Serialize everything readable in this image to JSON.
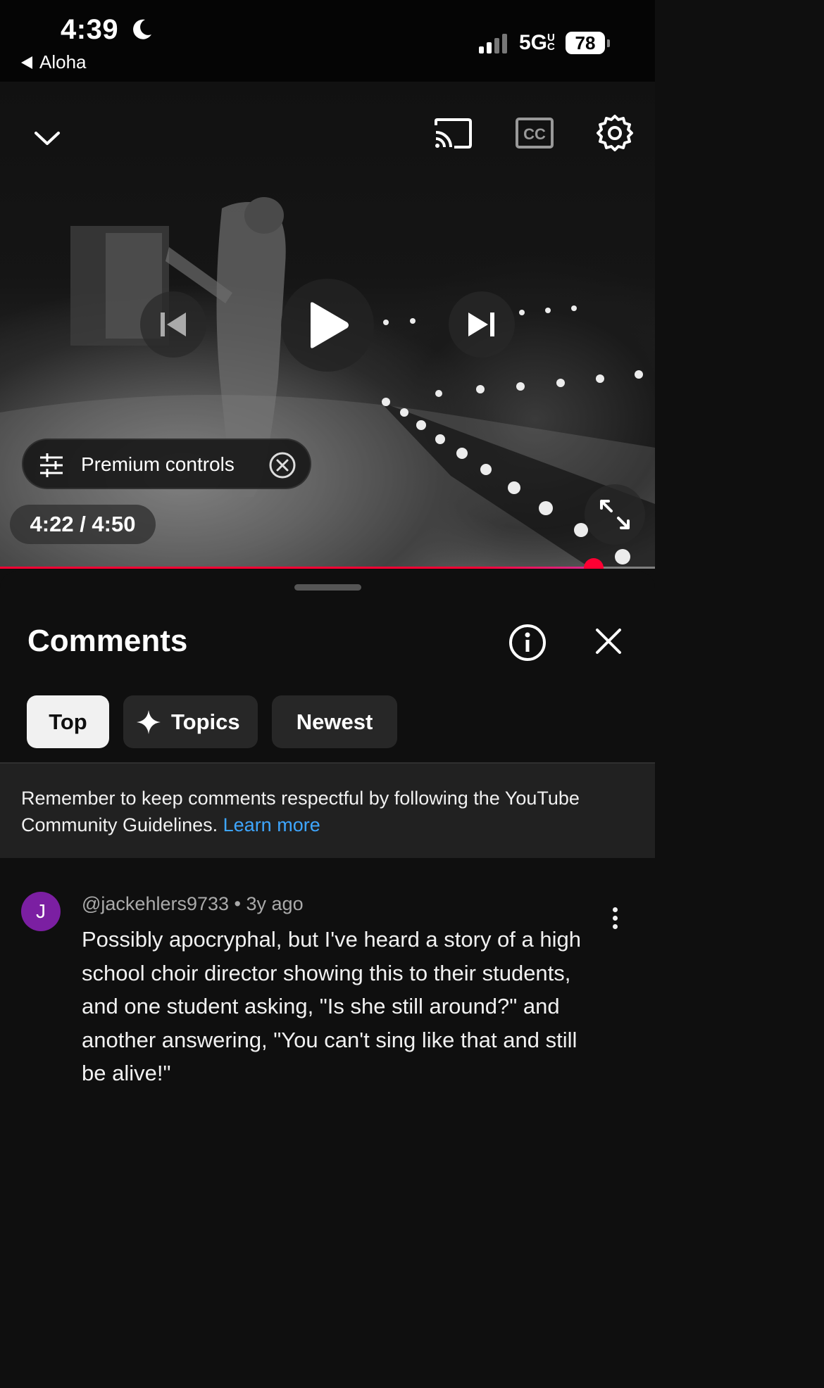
{
  "status_bar": {
    "time": "4:39",
    "back_app": "Aloha",
    "network": "5G",
    "battery": "78",
    "icons": [
      "moon-icon",
      "signal-icon",
      "battery-icon"
    ]
  },
  "player": {
    "premium_controls_label": "Premium controls",
    "time_display": "4:22 / 4:50",
    "progress": 0.906,
    "progress_color": "#ff0033",
    "icons": [
      "collapse-chevron-icon",
      "cast-icon",
      "cc-icon",
      "settings-gear-icon",
      "previous-icon",
      "play-icon",
      "next-icon",
      "sliders-icon",
      "close-circle-icon",
      "fullscreen-icon"
    ]
  },
  "comments": {
    "title": "Comments",
    "tabs": [
      {
        "label": "Top",
        "active": true
      },
      {
        "label": "Topics",
        "active": false
      },
      {
        "label": "Newest",
        "active": false
      }
    ],
    "notice_text": "Remember to keep comments respectful by following the YouTube Community Guidelines.",
    "notice_link": "Learn more",
    "link_color": "#3ea6ff",
    "items": [
      {
        "avatar_letter": "J",
        "avatar_color": "#7b1fa2",
        "author": "@jackehlers9733",
        "age": "3y ago",
        "text": "Possibly apocryphal, but I've heard a story of a high school choir director showing this to their students, and one student asking, \"Is she still around?\" and another answering, \"You can't sing like that and still be alive!\""
      }
    ]
  }
}
